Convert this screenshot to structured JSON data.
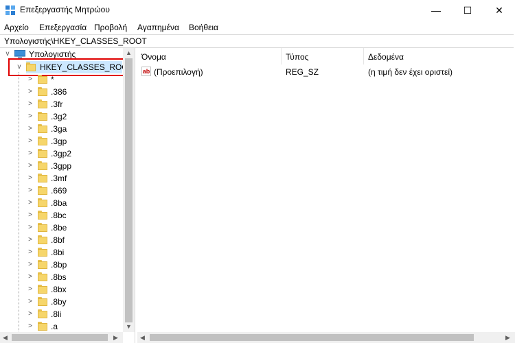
{
  "window": {
    "title": "Επεξεργαστής Μητρώου",
    "minimize_glyph": "—",
    "maximize_glyph": "☐",
    "close_glyph": "✕"
  },
  "menu": {
    "items": [
      "Αρχείο",
      "Επεξεργασία",
      "Προβολή",
      "Αγαπημένα",
      "Βοήθεια"
    ]
  },
  "address": {
    "path": "Υπολογιστής\\HKEY_CLASSES_ROOT"
  },
  "tree": {
    "root_label": "Υπολογιστής",
    "selected_label": "HKEY_CLASSES_ROOT",
    "children": [
      "*",
      ".386",
      ".3fr",
      ".3g2",
      ".3ga",
      ".3gp",
      ".3gp2",
      ".3gpp",
      ".3mf",
      ".669",
      ".8ba",
      ".8bc",
      ".8be",
      ".8bf",
      ".8bi",
      ".8bp",
      ".8bs",
      ".8bx",
      ".8by",
      ".8li",
      ".a"
    ]
  },
  "columns": {
    "name": "Όνομα",
    "type": "Τύπος",
    "data": "Δεδομένα"
  },
  "values": [
    {
      "name": "(Προεπιλογή)",
      "type": "REG_SZ",
      "data": "(η τιμή δεν έχει οριστεί)",
      "icon": "string-value-icon"
    }
  ],
  "colors": {
    "selection": "#cce8ff",
    "highlight": "#e00000",
    "folder": "#f6d66b"
  }
}
